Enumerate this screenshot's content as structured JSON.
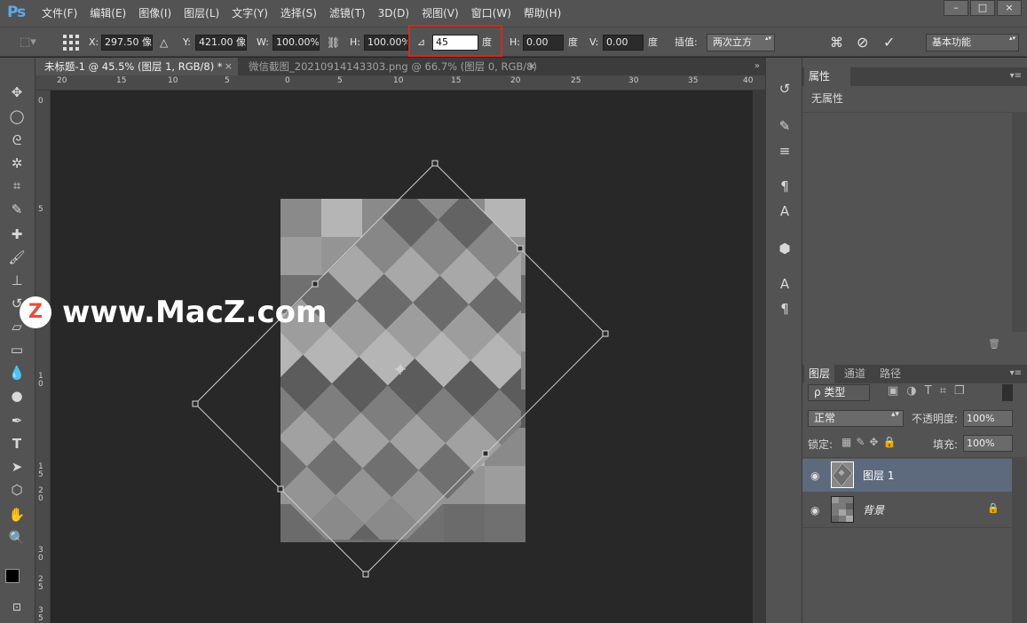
{
  "app": {
    "logo": "Ps"
  },
  "menubar": {
    "items": [
      "文件(F)",
      "编辑(E)",
      "图像(I)",
      "图层(L)",
      "文字(Y)",
      "选择(S)",
      "滤镜(T)",
      "3D(D)",
      "视图(V)",
      "窗口(W)",
      "帮助(H)"
    ],
    "window_controls": [
      "–",
      "□",
      "×"
    ]
  },
  "options": {
    "x_label": "X:",
    "x_value": "297.50 像",
    "y_label": "Y:",
    "y_value": "421.00 像",
    "w_label": "W:",
    "w_value": "100.00%",
    "h_label": "H:",
    "h_value": "100.00%",
    "angle_value": "45",
    "angle_unit": "度",
    "hskew_label": "H:",
    "hskew_value": "0.00",
    "hskew_unit": "度",
    "vskew_label": "V:",
    "vskew_value": "0.00",
    "vskew_unit": "度",
    "interp_label": "插值:",
    "interp_value": "两次立方",
    "workspace": "基本功能"
  },
  "tabs": [
    {
      "label": "未标题-1 @ 45.5% (图层 1, RGB/8) *",
      "active": true
    },
    {
      "label": "微信截图_20210914143303.png @ 66.7% (图层 0, RGB/8)",
      "active": false
    }
  ],
  "ruler_top": [
    "20",
    "15",
    "10",
    "5",
    "0",
    "5",
    "10",
    "15",
    "20",
    "25",
    "30",
    "35",
    "40"
  ],
  "ruler_left": [
    "0",
    "5",
    "1 0",
    "1 5",
    "2 0",
    "2 5",
    "3 0",
    "3 5"
  ],
  "properties": {
    "tab": "属性",
    "empty_text": "无属性"
  },
  "layers": {
    "tabs": [
      "图层",
      "通道",
      "路径"
    ],
    "filter_label": "ρ 类型",
    "blend_mode": "正常",
    "opacity_label": "不透明度:",
    "opacity_value": "100%",
    "lock_label": "锁定:",
    "fill_label": "填充:",
    "fill_value": "100%",
    "items": [
      {
        "name": "图层 1",
        "selected": true
      },
      {
        "name": "背景",
        "selected": false,
        "locked": true
      }
    ]
  },
  "watermark": {
    "logo": "Z",
    "text": "www.MacZ.com"
  },
  "colors": {
    "highlight": "#e0231b",
    "selection": "#5d6a7d"
  }
}
